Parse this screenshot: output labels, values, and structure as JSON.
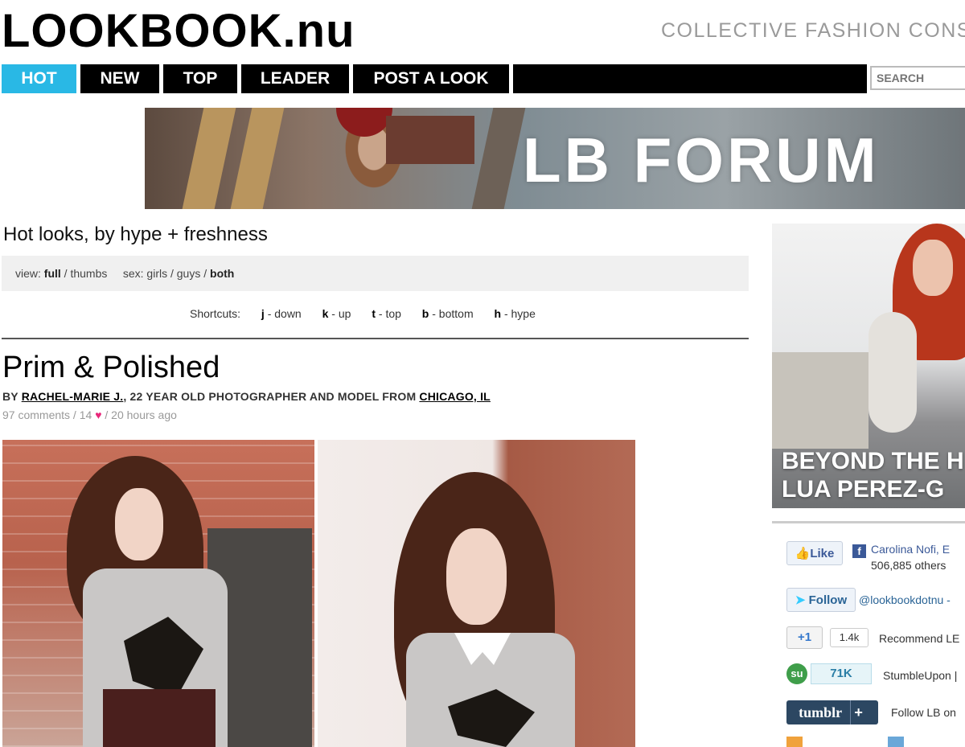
{
  "header": {
    "logo": "LOOKBOOK.nu",
    "tagline": "COLLECTIVE FASHION CONS"
  },
  "nav": {
    "tabs": [
      {
        "label": "HOT",
        "active": true
      },
      {
        "label": "NEW",
        "active": false
      },
      {
        "label": "TOP",
        "active": false
      },
      {
        "label": "LEADER",
        "active": false
      },
      {
        "label": "POST A LOOK",
        "active": false
      }
    ],
    "search_placeholder": "SEARCH"
  },
  "banner": {
    "text": "LB FORUM"
  },
  "main": {
    "heading": "Hot looks, by hype + freshness",
    "view": {
      "view_label": "view:",
      "view_full": "full",
      "sep1": " / ",
      "view_thumbs": "thumbs",
      "sex_label": "sex:",
      "sex_girls": "girls",
      "sep2": " / ",
      "sex_guys": "guys",
      "sep3": " / ",
      "sex_both": "both"
    },
    "shortcuts": {
      "label": "Shortcuts:",
      "items": [
        {
          "key": "j",
          "action": " - down"
        },
        {
          "key": "k",
          "action": " - up"
        },
        {
          "key": "t",
          "action": " - top"
        },
        {
          "key": "b",
          "action": " - bottom"
        },
        {
          "key": "h",
          "action": " - hype"
        }
      ]
    },
    "look": {
      "title": "Prim & Polished",
      "by": "BY ",
      "author": "RACHEL-MARIE J.",
      "desc": ", 22 YEAR OLD PHOTOGRAPHER AND MODEL FROM ",
      "location": "CHICAGO, IL",
      "comments": "97 comments",
      "hearts_prefix": " / 14",
      "heart_glyph": "♥",
      "time": " / 20 hours ago"
    }
  },
  "sidebar": {
    "feature_line1": "BEYOND THE H",
    "feature_line2": "LUA PEREZ-G",
    "fb_like": "Like",
    "fb_text_line1": "Carolina Nofi, E",
    "fb_text_line2": "506,885 others",
    "tw_follow": "Follow",
    "tw_handle": "@lookbookdotnu -",
    "gplus_label": "+1",
    "gplus_count": "1.4k",
    "gplus_text": "Recommend LE",
    "su_icon": "su",
    "su_count": "71K",
    "su_text": "StumbleUpon |",
    "tumblr_label": "tumblr",
    "tumblr_plus": "+",
    "tumblr_text": "Follow LB on"
  },
  "colors": {
    "nav_active": "#29b8e5",
    "nav_bg": "#000000",
    "heart": "#e8287a",
    "facebook": "#3b5998",
    "tumblr": "#2c4762"
  }
}
